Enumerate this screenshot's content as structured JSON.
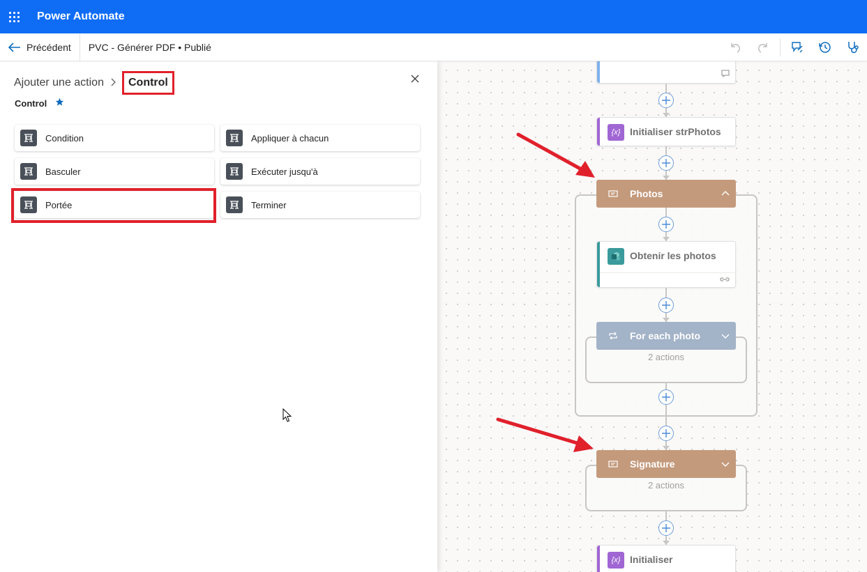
{
  "app": {
    "title": "Power Automate"
  },
  "command_bar": {
    "back_label": "Précédent",
    "flow_title": "PVC - Générer PDF • Publié",
    "icons": [
      "undo-icon",
      "redo-icon",
      "feedback-icon",
      "history-icon",
      "flow-checker-icon"
    ]
  },
  "panel": {
    "breadcrumb_root": "Ajouter une action",
    "breadcrumb_current": "Control",
    "section_title": "Control",
    "actions": [
      {
        "label": "Condition"
      },
      {
        "label": "Appliquer à chacun"
      },
      {
        "label": "Basculer"
      },
      {
        "label": "Exécuter jusqu'à"
      },
      {
        "label": "Portée"
      },
      {
        "label": "Terminer"
      }
    ]
  },
  "canvas": {
    "nodes": {
      "init_str_photos": "Initialiser strPhotos",
      "scope_photos": "Photos",
      "get_photos": "Obtenir les photos",
      "for_each_photo": "For each photo",
      "for_each_count": "2 actions",
      "scope_signature": "Signature",
      "signature_count": "2 actions",
      "init_bottom": "Initialiser"
    },
    "colors": {
      "scope": "#c49a7c",
      "loop": "#a3b3c8",
      "variable": "#a066d3",
      "sharepoint": "#3a9a9c"
    }
  }
}
